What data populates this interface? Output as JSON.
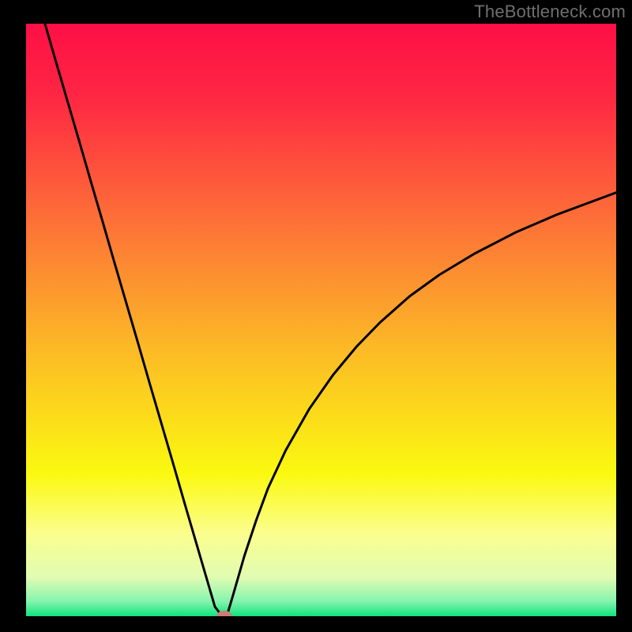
{
  "watermark": "TheBottleneck.com",
  "chart_data": {
    "type": "line",
    "title": "",
    "xlabel": "",
    "ylabel": "",
    "xlim": [
      0,
      100
    ],
    "ylim": [
      0,
      100
    ],
    "x": [
      3.2,
      5,
      7,
      9,
      11,
      13,
      15,
      17,
      19,
      21,
      23,
      25,
      27,
      29,
      31,
      32,
      33,
      33.6,
      34.1,
      35,
      37,
      39,
      41,
      44,
      48,
      52,
      56,
      60,
      65,
      70,
      76,
      83,
      90,
      100
    ],
    "values": [
      100,
      93.8,
      87,
      80.2,
      73.3,
      66.5,
      59.6,
      52.8,
      46,
      39.1,
      32.3,
      25.5,
      18.6,
      11.8,
      5,
      1.6,
      0.3,
      0,
      0.3,
      3.3,
      10.2,
      16.2,
      21.6,
      28,
      35,
      40.7,
      45.5,
      49.6,
      54,
      57.6,
      61.2,
      64.8,
      67.8,
      71.5
    ],
    "marker": {
      "x": 33.6,
      "y": 0
    },
    "gradient_stops": [
      {
        "offset": 0.0,
        "color": "#fe0f46"
      },
      {
        "offset": 0.12,
        "color": "#fe2643"
      },
      {
        "offset": 0.32,
        "color": "#fd6c38"
      },
      {
        "offset": 0.55,
        "color": "#fcba26"
      },
      {
        "offset": 0.76,
        "color": "#fbf910"
      },
      {
        "offset": 0.86,
        "color": "#fbfe8e"
      },
      {
        "offset": 0.935,
        "color": "#e0fcb2"
      },
      {
        "offset": 0.975,
        "color": "#84f4ad"
      },
      {
        "offset": 1.0,
        "color": "#0fe47c"
      }
    ]
  }
}
